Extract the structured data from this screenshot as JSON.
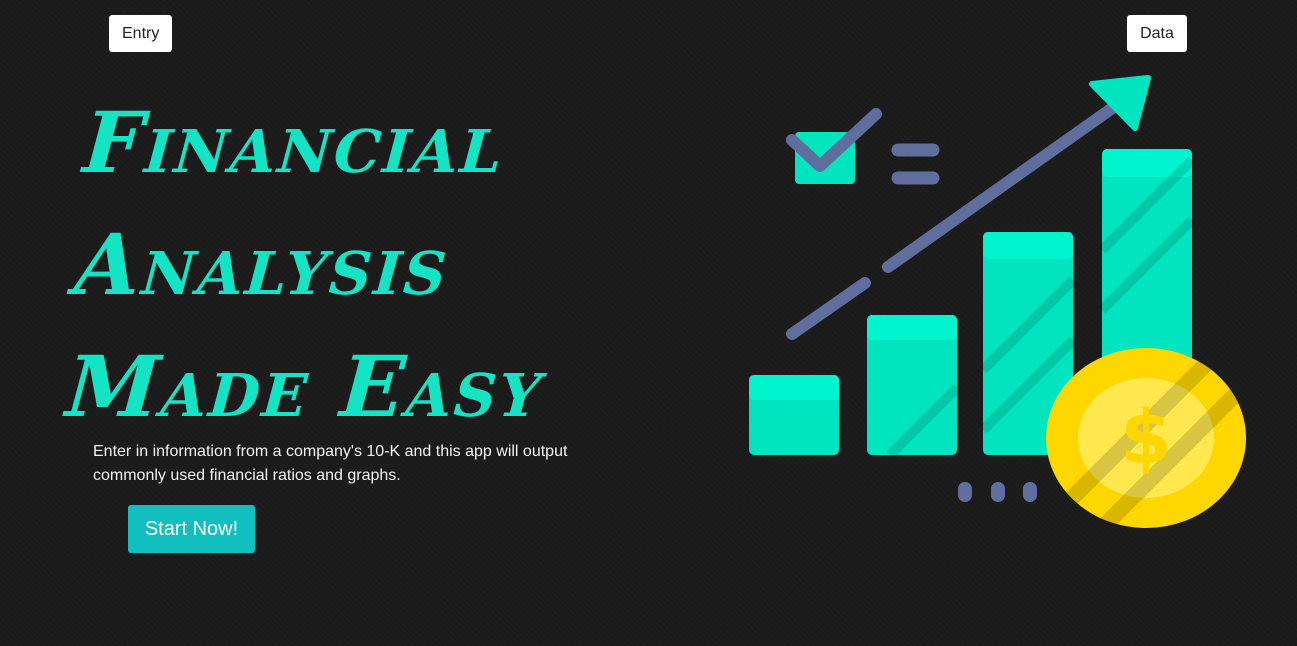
{
  "nav": {
    "entry_label": "Entry",
    "data_label": "Data"
  },
  "hero": {
    "title_lines": [
      "Financial",
      "Analysis",
      "Made Easy"
    ],
    "description": "Enter in information from a company's 10-K and this app will output commonly used financial ratios and graphs.",
    "cta_label": "Start Now!"
  },
  "illustration": {
    "coin_symbol": "$",
    "icons": [
      "checkbox-icon",
      "list-lines-icon",
      "trend-arrow-icon",
      "bar-chart-icon",
      "dollar-coin-icon",
      "dots-icon"
    ]
  },
  "colors": {
    "background": "#1b1b1b",
    "accent": "#14e3c4",
    "button": "#12bfbf",
    "coin": "#ffd700",
    "arrow": "#5f6e9c"
  }
}
